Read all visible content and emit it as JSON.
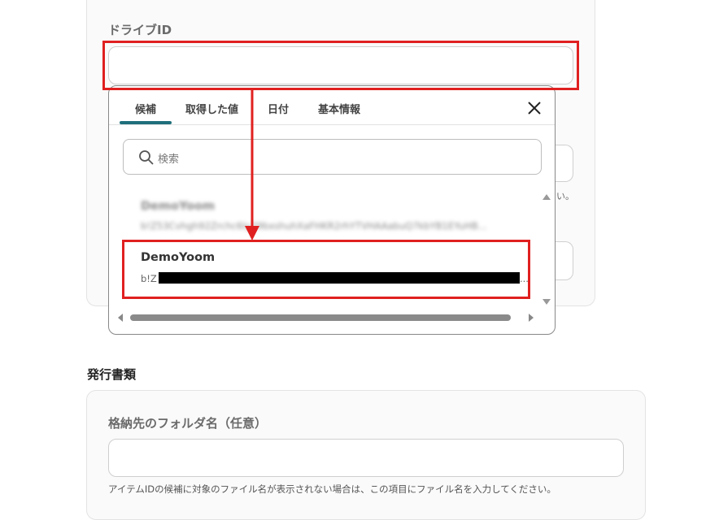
{
  "drive_id": {
    "label": "ドライブID",
    "value": ""
  },
  "popup": {
    "tabs": [
      "候補",
      "取得した値",
      "日付",
      "基本情報"
    ],
    "active_tab": "候補",
    "search_placeholder": "検索",
    "items": [
      {
        "title": "DemoYoom",
        "subtitle": "b!Z53Cvhgh92Zrchc6Iy29bxshuhXaFHKR2rhYTVHAAabuQ7kbYB1EYuHB...",
        "blurred": true
      },
      {
        "title": "DemoYoom",
        "subtitle_prefix": "b!Z",
        "subtitle_suffix": "...",
        "selected": true
      }
    ]
  },
  "background_hint": "い。",
  "section_title": "発行書類",
  "folder_field": {
    "label": "格納先のフォルダ名（任意）",
    "value": "",
    "helper": "アイテムIDの候補に対象のファイル名が表示されない場合は、この項目にファイル名を入力してください。"
  },
  "colors": {
    "highlight": "#e02020",
    "tab_active": "#1f6f7c"
  }
}
